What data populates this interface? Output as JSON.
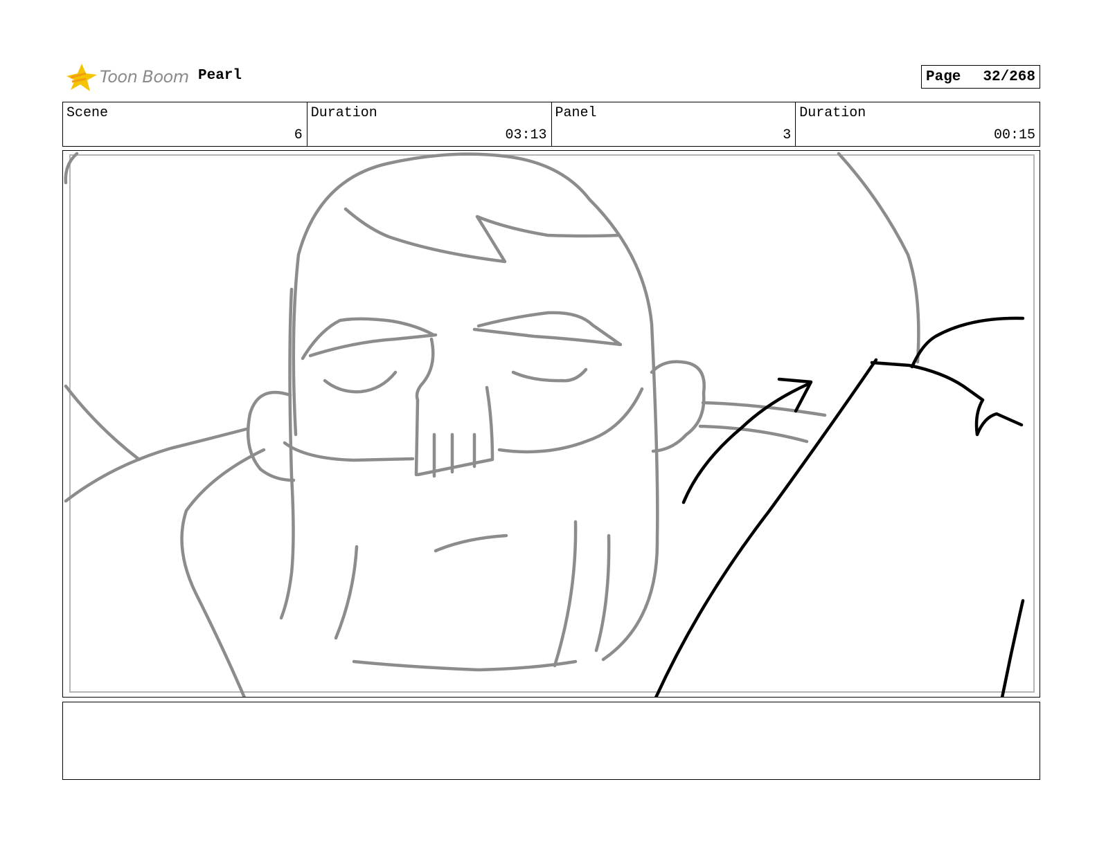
{
  "header": {
    "logo_text": "Toon Boom",
    "project_title": "Pearl",
    "page_label": "Page",
    "page_value": "32/268"
  },
  "info": [
    {
      "label": "Scene",
      "value": "6"
    },
    {
      "label": "Duration",
      "value": "03:13"
    },
    {
      "label": "Panel",
      "value": "3"
    },
    {
      "label": "Duration",
      "value": "00:15"
    }
  ],
  "colors": {
    "sketch_gray": "#8c8c8c",
    "sketch_black": "#000000",
    "logo_yellow": "#f5c400",
    "logo_orange": "#f39c12"
  },
  "notes": ""
}
